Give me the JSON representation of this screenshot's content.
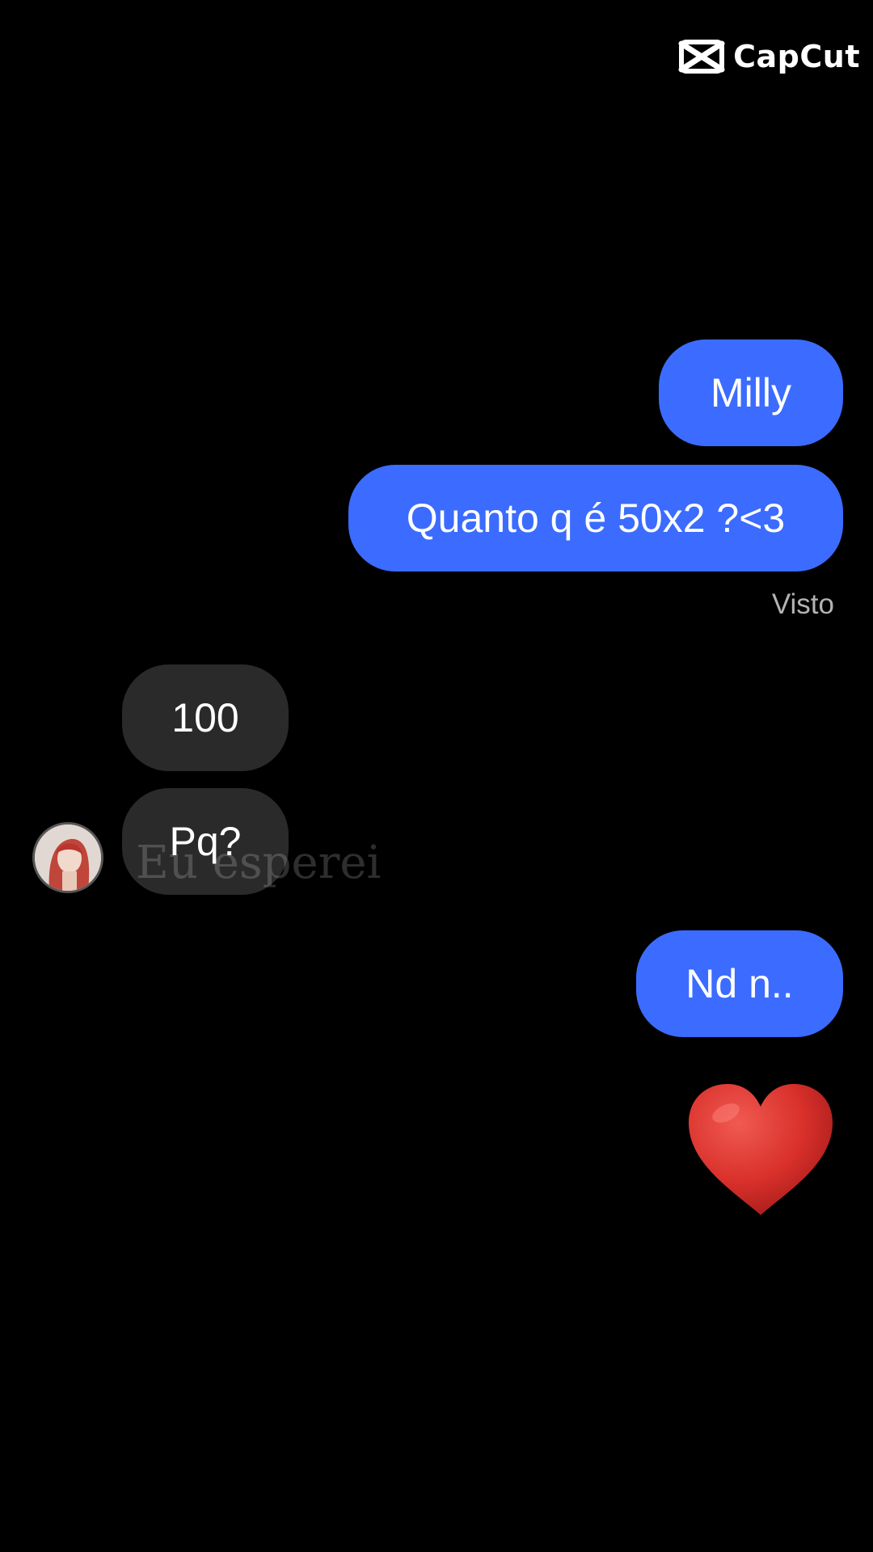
{
  "watermark": {
    "label": "CapCut",
    "icon": "capcut-logo-icon"
  },
  "conversation": {
    "messages": [
      {
        "sender": "me",
        "text": "Milly"
      },
      {
        "sender": "me",
        "text": "Quanto q é 50x2 ?<3"
      },
      {
        "sender": "other",
        "text": "100"
      },
      {
        "sender": "other",
        "text": "Pq?"
      },
      {
        "sender": "me",
        "text": "Nd n.."
      }
    ],
    "seen_status": "Visto",
    "reaction": {
      "icon": "heart-icon",
      "color": "#e0312e"
    }
  },
  "subtitle": {
    "text": "Eu esperei"
  },
  "colors": {
    "background": "#000000",
    "outgoing_bubble": "#3b6cff",
    "incoming_bubble": "#2a2a2a",
    "seen_text": "#b3b3b3"
  }
}
